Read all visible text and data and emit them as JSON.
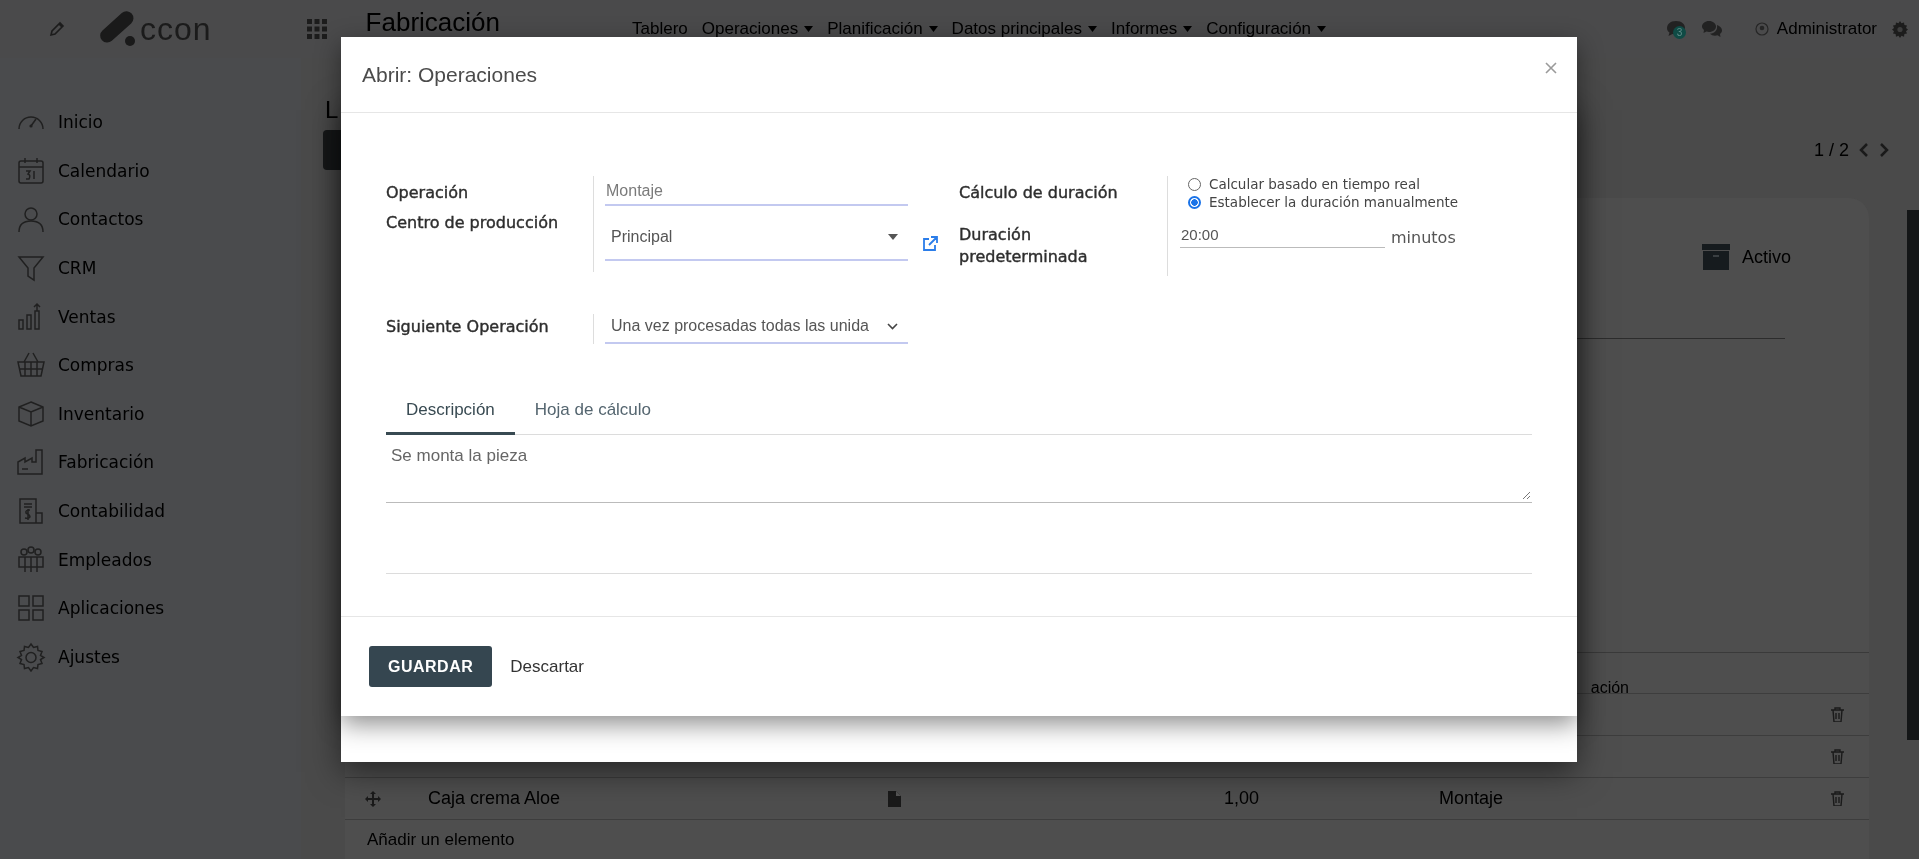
{
  "topbar": {
    "logo_text": "ccon",
    "app_title": "Fabricación",
    "menu": [
      {
        "label": "Tablero",
        "dropdown": false
      },
      {
        "label": "Operaciones",
        "dropdown": true
      },
      {
        "label": "Planificación",
        "dropdown": true
      },
      {
        "label": "Datos principales",
        "dropdown": true
      },
      {
        "label": "Informes",
        "dropdown": true
      },
      {
        "label": "Configuración",
        "dropdown": true
      }
    ],
    "notification_count": "3",
    "user": "Administrator"
  },
  "sidebar": {
    "items": [
      {
        "label": "Inicio"
      },
      {
        "label": "Calendario"
      },
      {
        "label": "Contactos"
      },
      {
        "label": "CRM"
      },
      {
        "label": "Ventas"
      },
      {
        "label": "Compras"
      },
      {
        "label": "Inventario"
      },
      {
        "label": "Fabricación"
      },
      {
        "label": "Contabilidad"
      },
      {
        "label": "Empleados"
      },
      {
        "label": "Aplicaciones"
      },
      {
        "label": "Ajustes"
      }
    ]
  },
  "background": {
    "title": "L",
    "pager": "1 / 2",
    "status_button": "Activo",
    "table": {
      "header": "ación",
      "rows": [
        {},
        {},
        {
          "cells": [
            "Caja crema Aloe",
            "1,00",
            "Montaje"
          ]
        }
      ],
      "add_line": "Añadir un elemento"
    }
  },
  "dialog": {
    "title": "Abrir: Operaciones",
    "left_fields": [
      {
        "label": "Operación",
        "kind": "text",
        "value": "Montaje",
        "external_link": false
      },
      {
        "label": "Centro de producción",
        "kind": "dropdown",
        "value": "Principal",
        "external_link": true
      }
    ],
    "next_operation": {
      "label": "Siguiente Operación",
      "kind": "select",
      "value": "Una vez procesadas todas las unida"
    },
    "duration_calculation": {
      "label": "Cálculo de duración",
      "options": [
        {
          "label": "Calcular basado en tiempo real",
          "selected": false
        },
        {
          "label": "Establecer la duración manualmente",
          "selected": true
        }
      ]
    },
    "default_duration": {
      "label": "Duración predeterminada",
      "value": "20:00",
      "unit": "minutos"
    },
    "tabs": [
      {
        "label": "Descripción",
        "selected": true
      },
      {
        "label": "Hoja de cálculo",
        "selected": false
      }
    ],
    "description": "Se monta la pieza",
    "buttons": [
      {
        "label": "GUARDAR",
        "kind": "primary"
      },
      {
        "label": "Descartar",
        "kind": "link"
      }
    ]
  }
}
